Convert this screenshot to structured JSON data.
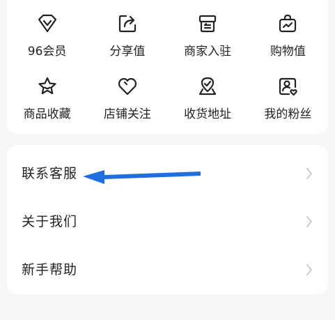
{
  "grid": {
    "items": [
      {
        "label": "96会员",
        "icon": "diamond-icon"
      },
      {
        "label": "分享值",
        "icon": "share-icon"
      },
      {
        "label": "商家入驻",
        "icon": "store-box-icon"
      },
      {
        "label": "购物值",
        "icon": "shopping-bag-icon"
      },
      {
        "label": "商品收藏",
        "icon": "star-icon"
      },
      {
        "label": "店铺关注",
        "icon": "heart-icon"
      },
      {
        "label": "收货地址",
        "icon": "location-icon"
      },
      {
        "label": "我的粉丝",
        "icon": "fans-icon"
      }
    ]
  },
  "list": {
    "items": [
      {
        "label": "联系客服"
      },
      {
        "label": "关于我们"
      },
      {
        "label": "新手帮助"
      }
    ]
  },
  "colors": {
    "background": "#f5f6f8",
    "card": "#ffffff",
    "text": "#222222",
    "chevron": "#cccccc",
    "annotation_arrow": "#1f6fe0"
  }
}
